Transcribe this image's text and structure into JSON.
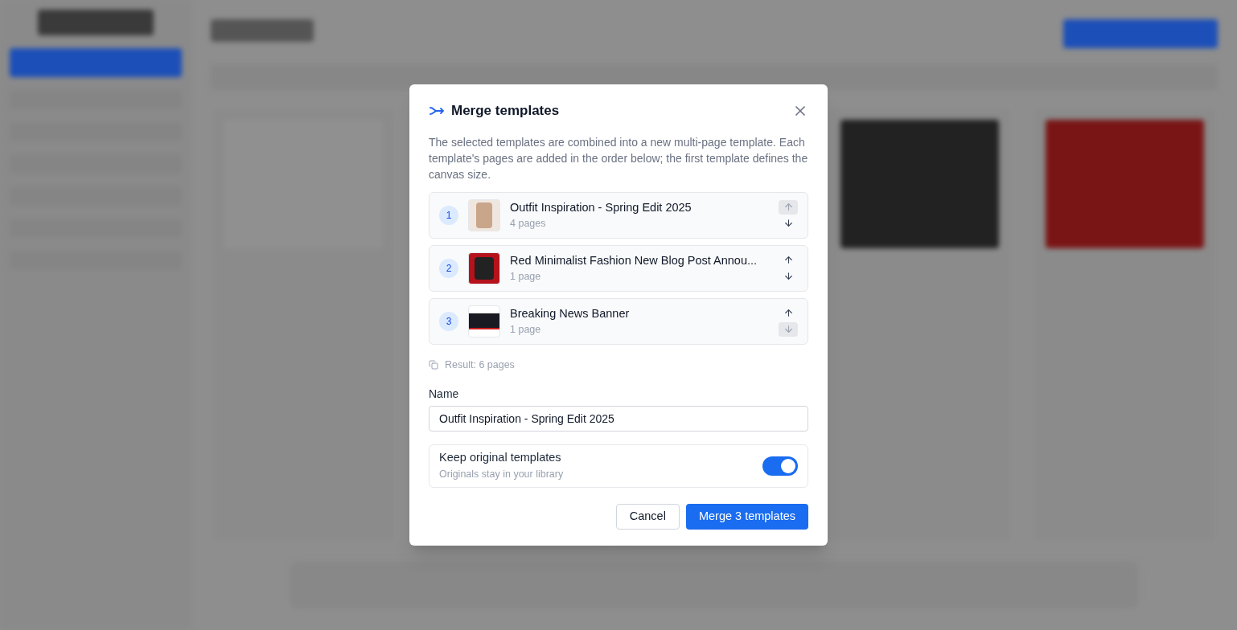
{
  "dialog": {
    "title": "Merge templates",
    "description": "The selected templates are combined into a new multi-page template. Each template's pages are added in the order below; the first template defines the canvas size.",
    "items": [
      {
        "index": "1",
        "title": "Outfit Inspiration - Spring Edit 2025",
        "pages": "4 pages",
        "kind": "fashion",
        "up_disabled": true,
        "down_disabled": false
      },
      {
        "index": "2",
        "title": "Red Minimalist Fashion New Blog Post Annou...",
        "pages": "1 page",
        "kind": "red",
        "up_disabled": false,
        "down_disabled": false
      },
      {
        "index": "3",
        "title": "Breaking News Banner",
        "pages": "1 page",
        "kind": "banner",
        "up_disabled": false,
        "down_disabled": true
      }
    ],
    "result": "Result: 6 pages",
    "name_label": "Name",
    "name_value": "Outfit Inspiration - Spring Edit 2025",
    "keep": {
      "label": "Keep original templates",
      "hint": "Originals stay in your library",
      "on": true
    },
    "buttons": {
      "cancel": "Cancel",
      "confirm": "Merge 3 templates"
    }
  }
}
